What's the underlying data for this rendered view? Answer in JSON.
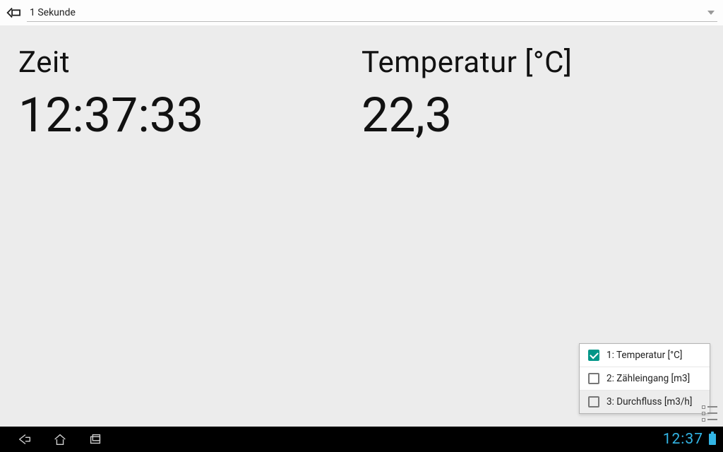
{
  "topbar": {
    "refresh_label": "1 Sekunde"
  },
  "readings": {
    "time_label": "Zeit",
    "time_value": "12:37:33",
    "temp_label": "Temperatur [°C]",
    "temp_value": "22,3"
  },
  "channels": [
    {
      "label": "1: Temperatur [°C]",
      "checked": true,
      "highlight": false
    },
    {
      "label": "2: Zähleingang [m3]",
      "checked": false,
      "highlight": false
    },
    {
      "label": "3: Durchfluss [m3/h]",
      "checked": false,
      "highlight": true
    }
  ],
  "statusbar": {
    "clock": "12:37"
  }
}
